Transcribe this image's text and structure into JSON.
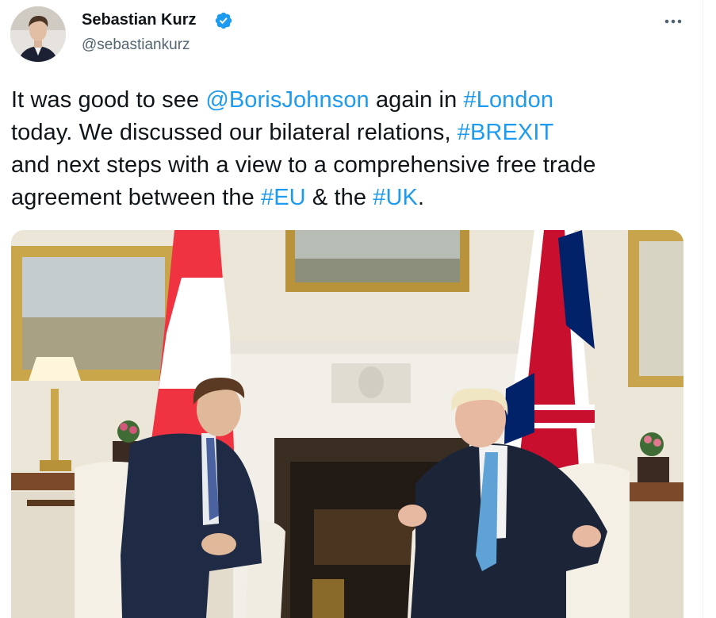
{
  "tweet": {
    "author_name": "Sebastian Kurz",
    "author_handle": "@sebastiankurz",
    "text": {
      "p1": "It was good to see ",
      "mention": "@BorisJohnson",
      "p2": "  again in ",
      "tag_london": "#London",
      "p3": "today. We discussed our bilateral relations, ",
      "tag_brexit": "#BREXIT",
      "p4": "and next steps with a view to a comprehensive free trade agreement between the ",
      "tag_eu": "#EU",
      "p5": " & the ",
      "tag_uk": "#UK",
      "p6": "."
    }
  },
  "colors": {
    "link": "#1d9bf0",
    "verified": "#1d9bf0",
    "handle": "#536471"
  },
  "icons": {
    "verified": "verified-badge-icon",
    "more": "more-options-icon"
  }
}
